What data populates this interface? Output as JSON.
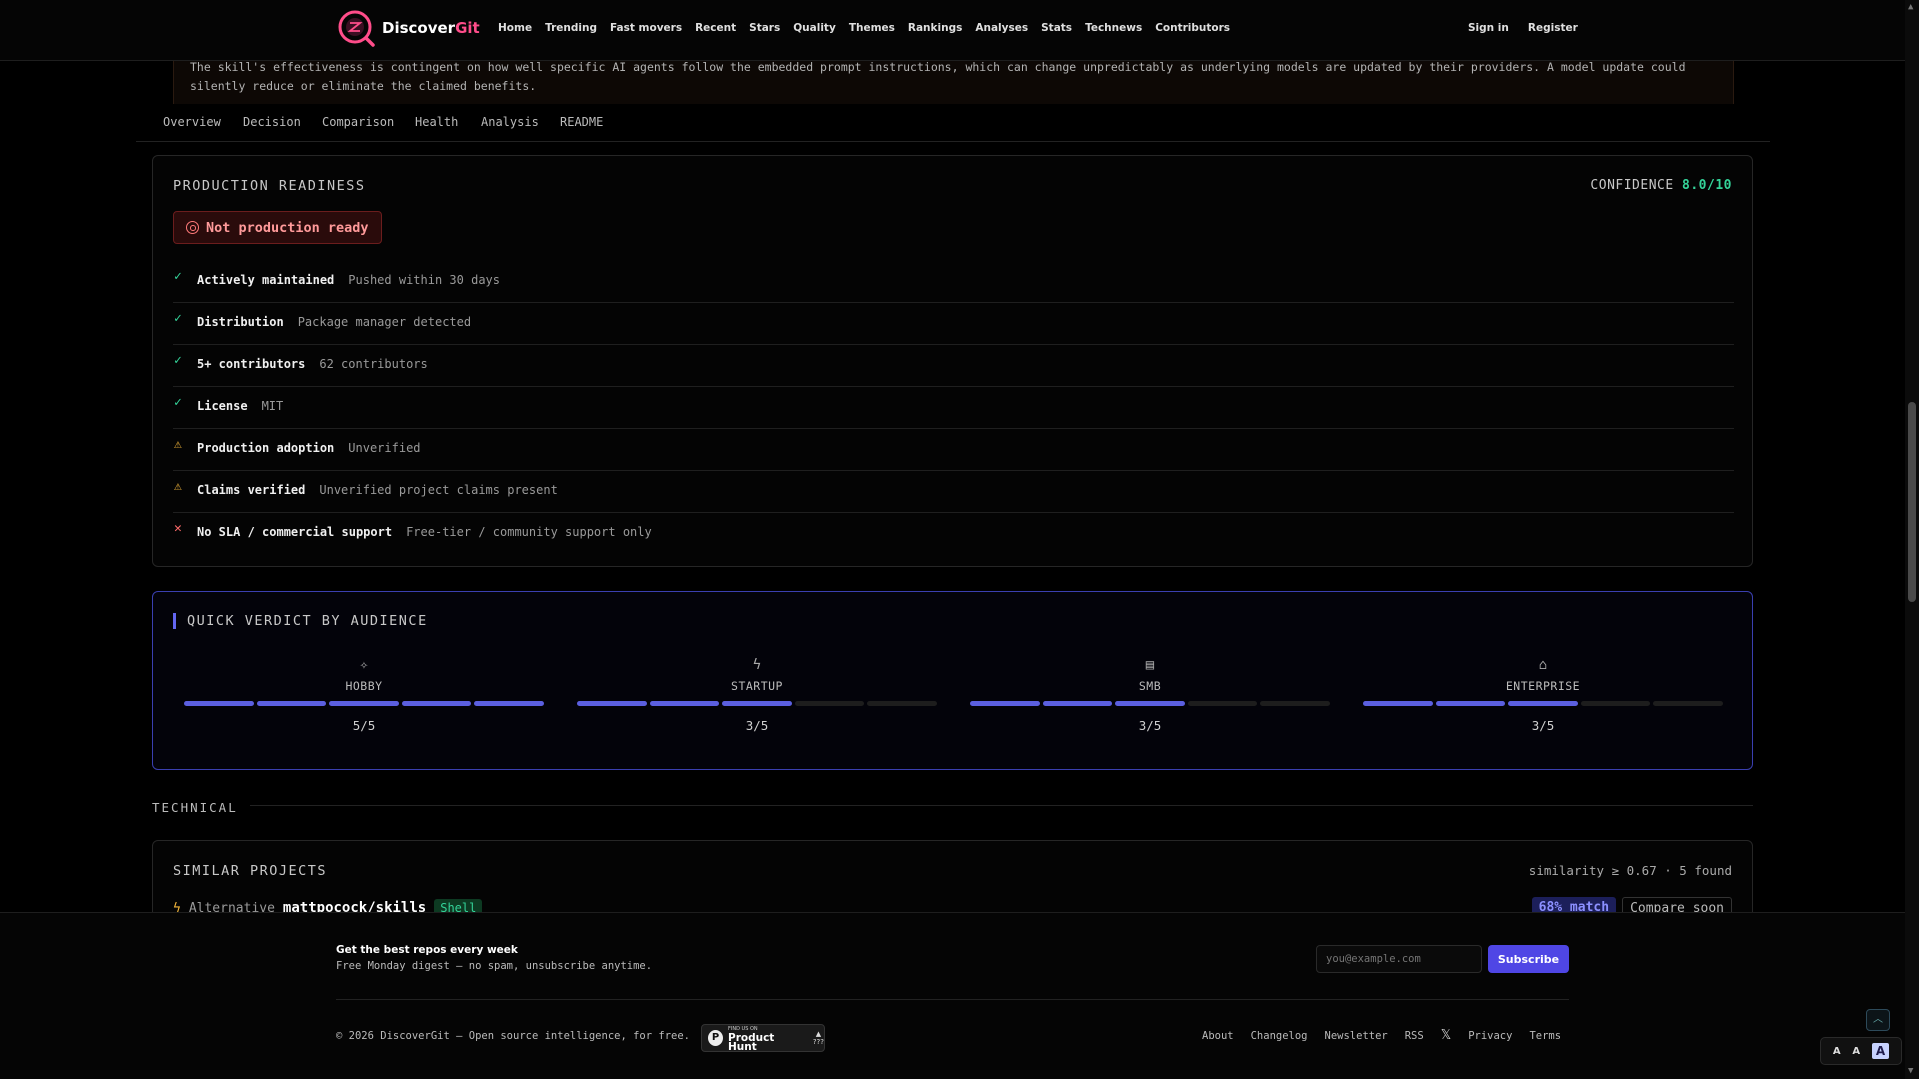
{
  "nav": {
    "brand_prefix": "Discover",
    "brand_suffix": "Git",
    "links": [
      "Home",
      "Trending",
      "Fast movers",
      "Recent",
      "Stars",
      "Quality",
      "Themes",
      "Rankings",
      "Analyses",
      "Stats",
      "Technews",
      "Contributors"
    ],
    "sign_in": "Sign in",
    "register": "Register"
  },
  "warning": {
    "text": "The skill's effectiveness is contingent on how well specific AI agents follow the embedded prompt instructions, which can change unpredictably as underlying models are updated by their providers. A model update could silently reduce or eliminate the claimed benefits."
  },
  "tabs": [
    "Overview",
    "Decision",
    "Comparison",
    "Health",
    "Analysis",
    "README"
  ],
  "production": {
    "title": "PRODUCTION READINESS",
    "confidence_label": "CONFIDENCE",
    "confidence_value": "8.0/10",
    "status": "Not production ready",
    "rows": [
      {
        "status": "ok",
        "label": "Actively maintained",
        "detail": "Pushed within 30 days"
      },
      {
        "status": "ok",
        "label": "Distribution",
        "detail": "Package manager detected"
      },
      {
        "status": "ok",
        "label": "5+ contributors",
        "detail": "62 contributors"
      },
      {
        "status": "ok",
        "label": "License",
        "detail": "MIT"
      },
      {
        "status": "warn",
        "label": "Production adoption",
        "detail": "Unverified"
      },
      {
        "status": "warn",
        "label": "Claims verified",
        "detail": "Unverified project claims present"
      },
      {
        "status": "bad",
        "label": "No SLA / commercial support",
        "detail": "Free-tier / community support only"
      }
    ]
  },
  "verdict": {
    "title": "QUICK VERDICT BY AUDIENCE",
    "audiences": [
      {
        "icon": "sparkle-icon",
        "name": "HOBBY",
        "score": 5,
        "max": 5,
        "label": "5/5"
      },
      {
        "icon": "lightning-icon",
        "name": "STARTUP",
        "score": 3,
        "max": 5,
        "label": "3/5"
      },
      {
        "icon": "building-icon",
        "name": "SMB",
        "score": 3,
        "max": 5,
        "label": "3/5"
      },
      {
        "icon": "bank-icon",
        "name": "ENTERPRISE",
        "score": 3,
        "max": 5,
        "label": "3/5"
      }
    ]
  },
  "technical": {
    "label": "TECHNICAL"
  },
  "similar": {
    "title": "SIMILAR PROJECTS",
    "meta": "similarity ≥ 0.67 · 5 found",
    "item": {
      "kind": "Alternative",
      "repo": "mattpocock/skills",
      "language": "Shell",
      "match": "68% match",
      "compare": "Compare soon"
    }
  },
  "footer": {
    "newsletter_title": "Get the best repos every week",
    "newsletter_sub": "Free Monday digest — no spam, unsubscribe anytime.",
    "email_placeholder": "you@example.com",
    "subscribe": "Subscribe",
    "copyright": "© 2026 DiscoverGit — Open source intelligence, for free.",
    "product_hunt_small": "FIND US ON",
    "product_hunt": "Product Hunt",
    "product_hunt_count": "???",
    "links": [
      "About",
      "Changelog",
      "Newsletter",
      "RSS"
    ],
    "x_icon": "x-icon",
    "links2": [
      "Privacy",
      "Terms"
    ]
  },
  "font_size_options": [
    "A",
    "A",
    "A"
  ],
  "colors": {
    "accent": "#5b5fe0",
    "ok": "#34d399",
    "warn": "#f5b73b",
    "bad": "#ff6b6b",
    "brand": "#ff4d8a"
  }
}
